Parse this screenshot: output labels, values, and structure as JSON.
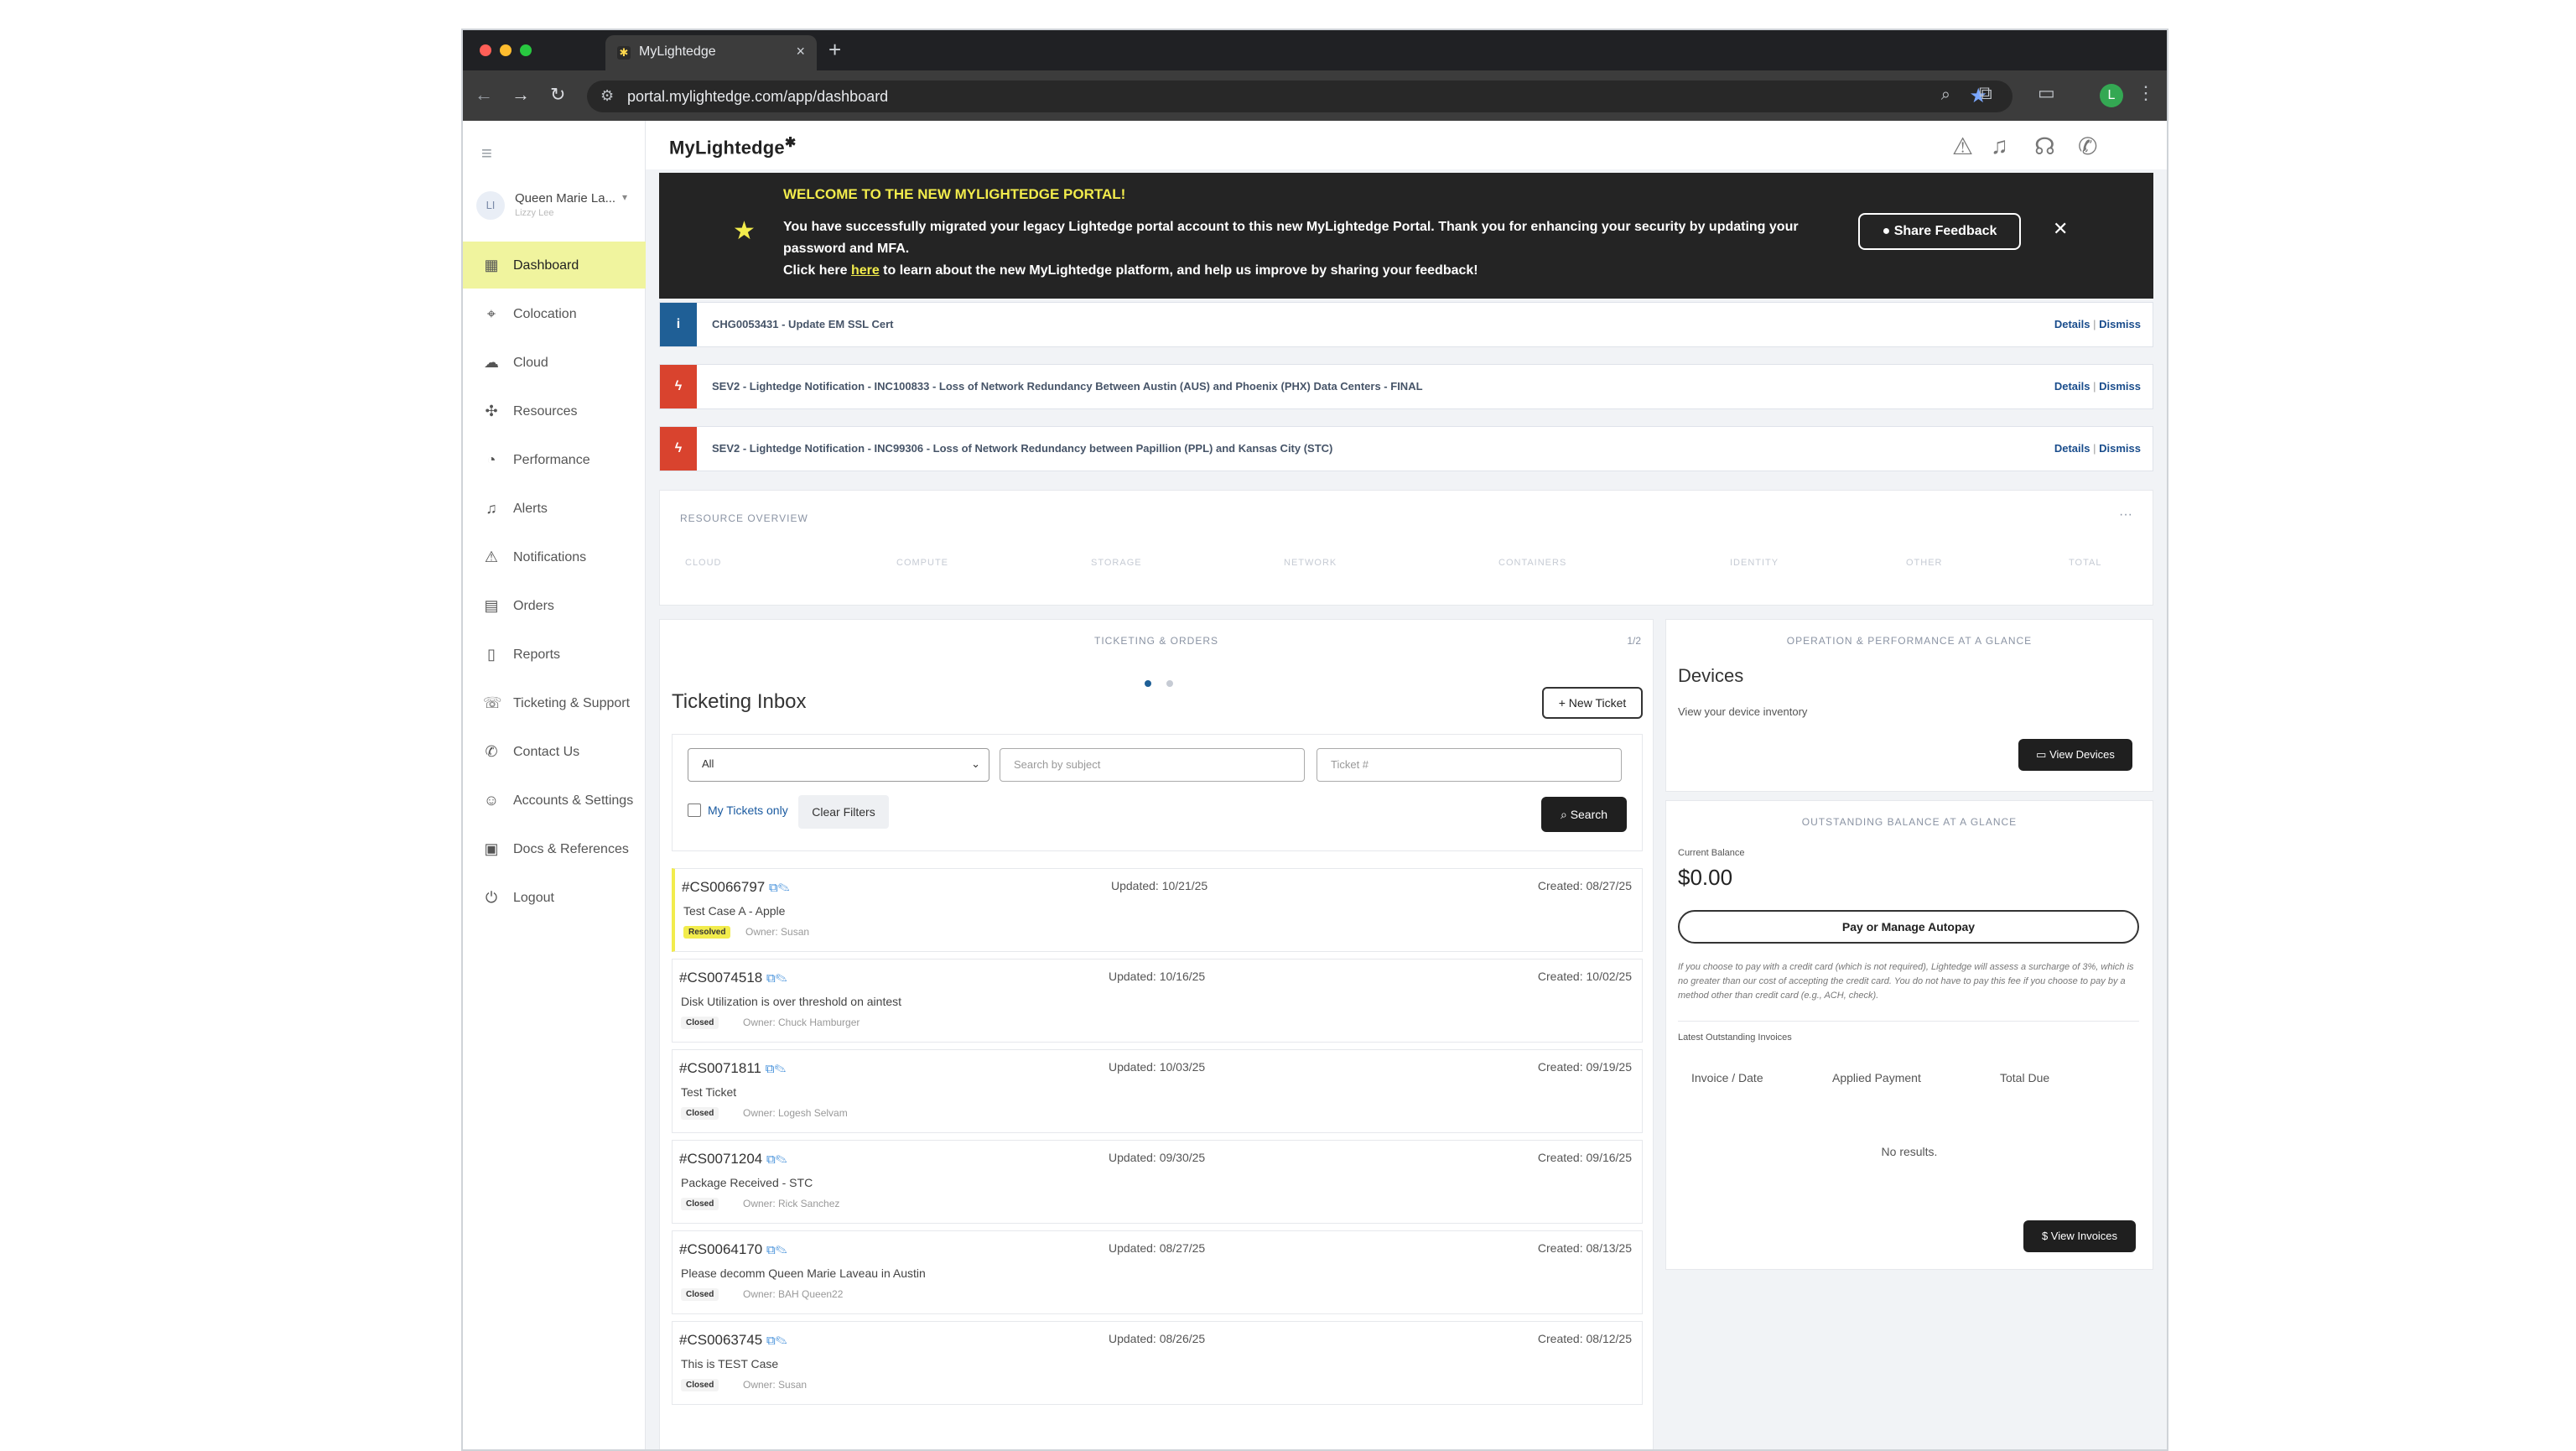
{
  "browser": {
    "tab_title": "MyLightedge",
    "url": "portal.mylightedge.com/app/dashboard",
    "profile_initial": "L"
  },
  "sidebar": {
    "user_name": "Queen Marie La...",
    "user_sub": "Lizzy Lee",
    "avatar_initials": "LI",
    "items": [
      {
        "label": "Dashboard",
        "icon": "dashboard-icon"
      },
      {
        "label": "Colocation",
        "icon": "location-pin-icon"
      },
      {
        "label": "Cloud",
        "icon": "cloud-icon"
      },
      {
        "label": "Resources",
        "icon": "resources-icon"
      },
      {
        "label": "Performance",
        "icon": "gauge-icon"
      },
      {
        "label": "Alerts",
        "icon": "bell-icon"
      },
      {
        "label": "Notifications",
        "icon": "warning-icon"
      },
      {
        "label": "Orders",
        "icon": "orders-icon"
      },
      {
        "label": "Reports",
        "icon": "document-icon"
      },
      {
        "label": "Ticketing & Support",
        "icon": "support-icon"
      },
      {
        "label": "Contact Us",
        "icon": "phone-icon"
      },
      {
        "label": "Accounts & Settings",
        "icon": "users-icon"
      },
      {
        "label": "Docs & References",
        "icon": "docs-icon"
      },
      {
        "label": "Logout",
        "icon": "power-icon"
      }
    ]
  },
  "header": {
    "logo": "MyLightedge"
  },
  "banner": {
    "title": "WELCOME TO THE NEW MYLIGHTEDGE PORTAL!",
    "line1": "You have successfully migrated your legacy Lightedge portal account to this new MyLightedge Portal. Thank you for enhancing your security by updating your password and MFA.",
    "line2_pre": "Click here ",
    "line2_link": "here",
    "line2_post": " to learn about the new MyLightedge platform, and help us improve by sharing your feedback!",
    "feedback_button": "Share Feedback"
  },
  "alerts": [
    {
      "text": "CHG0053431 - Update EM SSL Cert",
      "details": "Details",
      "dismiss": "Dismiss",
      "color": "#1f5f96"
    },
    {
      "text": "SEV2 - Lightedge Notification - INC100833 - Loss of Network Redundancy Between Austin (AUS) and Phoenix (PHX) Data Centers - FINAL",
      "details": "Details",
      "dismiss": "Dismiss",
      "color": "#d9432e"
    },
    {
      "text": "SEV2 - Lightedge Notification - INC99306 - Loss of Network Redundancy between Papillion (PPL) and Kansas City (STC)",
      "details": "Details",
      "dismiss": "Dismiss",
      "color": "#d9432e"
    }
  ],
  "resource_overview": {
    "title": "RESOURCE OVERVIEW",
    "columns": [
      "CLOUD",
      "COMPUTE",
      "STORAGE",
      "NETWORK",
      "CONTAINERS",
      "IDENTITY",
      "OTHER",
      "TOTAL"
    ]
  },
  "ticketing": {
    "section_title": "TICKETING & ORDERS",
    "page": "1/2",
    "inbox_title": "Ticketing Inbox",
    "new_ticket": "New Ticket",
    "filter_select": "All",
    "search_subject_placeholder": "Search by subject",
    "ticket_no_placeholder": "Ticket #",
    "my_tickets_only": "My Tickets only",
    "clear_filters": "Clear Filters",
    "search": "Search",
    "tickets": [
      {
        "id": "#CS0066797",
        "title": "Test Case A - Apple",
        "status": "Resolved",
        "owner": "Owner:  Susan",
        "updated": "Updated: 10/21/25",
        "created": "Created: 08/27/25"
      },
      {
        "id": "#CS0074518",
        "title": "Disk Utilization is over threshold on aintest",
        "status": "Closed",
        "owner": "Owner:  Chuck Hamburger",
        "updated": "Updated: 10/16/25",
        "created": "Created: 10/02/25"
      },
      {
        "id": "#CS0071811",
        "title": "Test Ticket",
        "status": "Closed",
        "owner": "Owner:  Logesh Selvam",
        "updated": "Updated: 10/03/25",
        "created": "Created: 09/19/25"
      },
      {
        "id": "#CS0071204",
        "title": "Package Received - STC",
        "status": "Closed",
        "owner": "Owner:  Rick Sanchez",
        "updated": "Updated: 09/30/25",
        "created": "Created: 09/16/25"
      },
      {
        "id": "#CS0064170",
        "title": "Please decomm Queen Marie Laveau in Austin",
        "status": "Closed",
        "owner": "Owner:  BAH Queen22",
        "updated": "Updated: 08/27/25",
        "created": "Created: 08/13/25"
      },
      {
        "id": "#CS0063745",
        "title": "This is TEST Case",
        "status": "Closed",
        "owner": "Owner:  Susan",
        "updated": "Updated: 08/26/25",
        "created": "Created: 08/12/25"
      }
    ]
  },
  "operations": {
    "section_title": "OPERATION & PERFORMANCE AT A GLANCE",
    "devices_title": "Devices",
    "devices_sub": "View your device inventory",
    "view_devices": "View Devices"
  },
  "balance": {
    "section_title": "OUTSTANDING BALANCE AT A GLANCE",
    "current_balance_label": "Current Balance",
    "balance": "$0.00",
    "pay_button": "Pay or Manage Autopay",
    "note": "If you choose to pay with a credit card (which is not required), Lightedge will assess a surcharge of 3%, which is no greater than our cost of accepting the credit card. You do not have to pay this fee if you choose to pay by a method other than credit card (e.g., ACH, check).",
    "latest_label": "Latest Outstanding Invoices",
    "columns": [
      "Invoice / Date",
      "Applied Payment",
      "Total Due"
    ],
    "no_results": "No results.",
    "view_invoices": "View Invoices"
  }
}
